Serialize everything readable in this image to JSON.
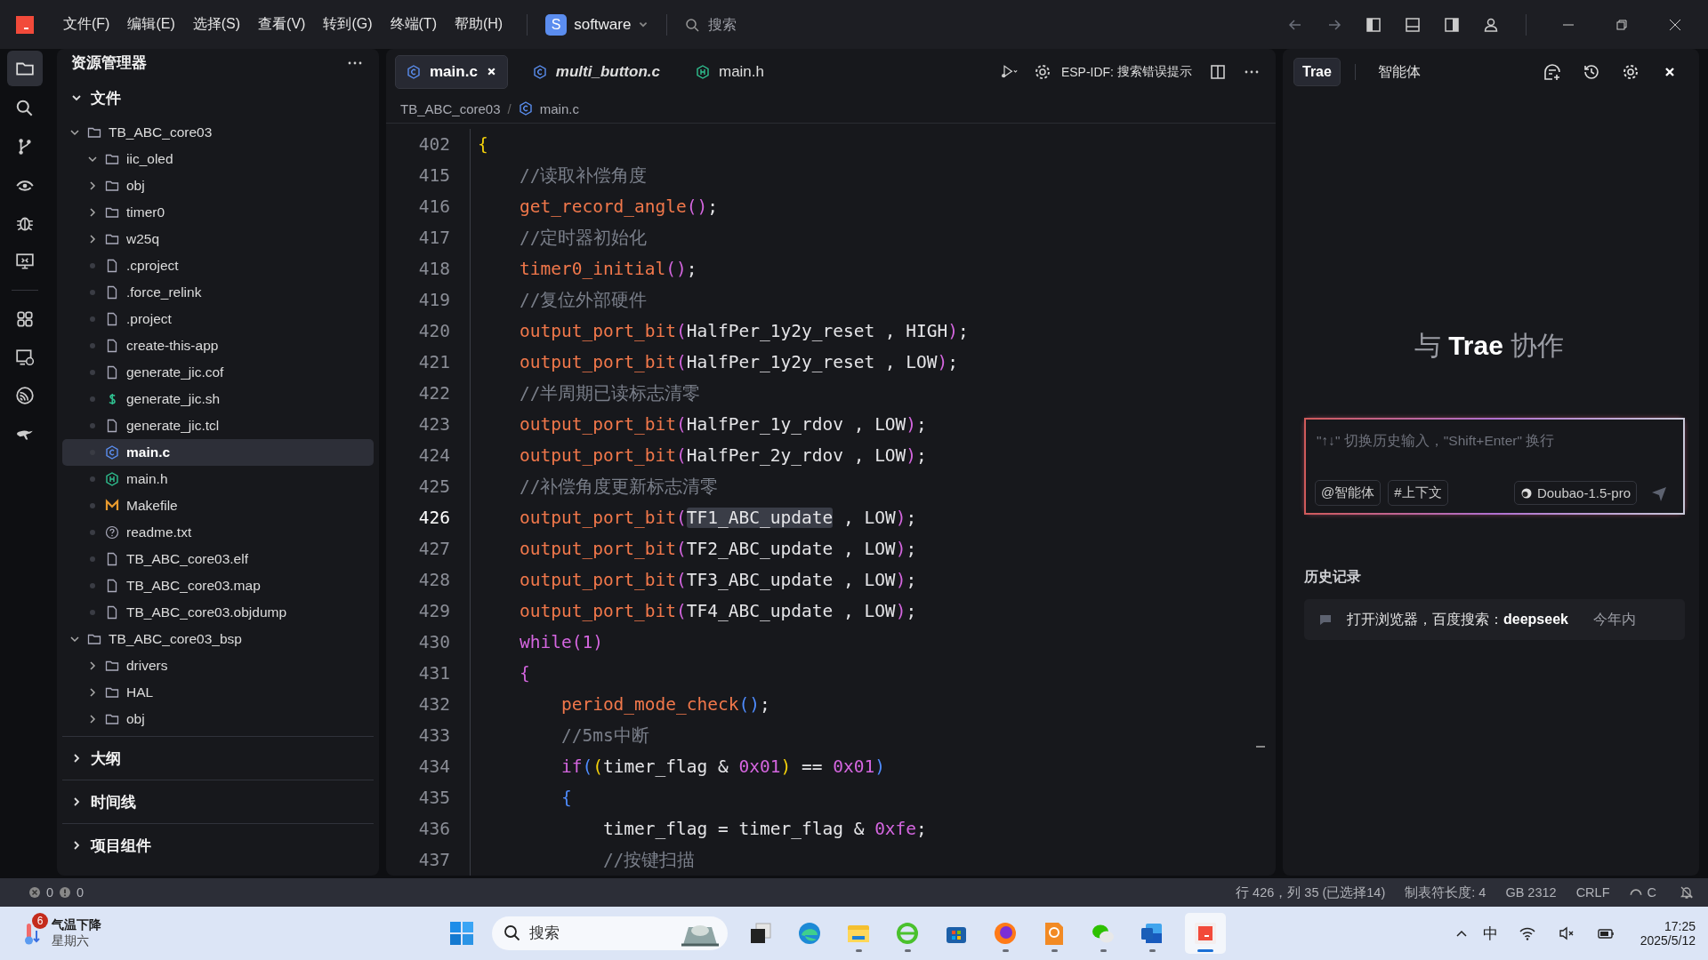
{
  "titlebar": {
    "menus": [
      "文件(F)",
      "编辑(E)",
      "选择(S)",
      "查看(V)",
      "转到(G)",
      "终端(T)",
      "帮助(H)"
    ],
    "project": {
      "badge": "S",
      "name": "software"
    },
    "search": {
      "placeholder": "搜索"
    }
  },
  "sidebar": {
    "title": "资源管理器",
    "sections": [
      {
        "title": "文件",
        "expanded": true,
        "tree": [
          {
            "name": "TB_ABC_core03",
            "kind": "folder",
            "expanded": true,
            "selected": false,
            "children": [
              {
                "name": "iic_oled",
                "kind": "folder",
                "expanded": true,
                "selected": false
              },
              {
                "name": "obj",
                "kind": "folder",
                "expanded": false,
                "selected": false
              },
              {
                "name": "timer0",
                "kind": "folder",
                "expanded": false,
                "selected": false
              },
              {
                "name": "w25q",
                "kind": "folder",
                "expanded": false,
                "selected": false
              },
              {
                "name": ".cproject",
                "kind": "file",
                "selected": false
              },
              {
                "name": ".force_relink",
                "kind": "file",
                "selected": false
              },
              {
                "name": ".project",
                "kind": "file",
                "selected": false
              },
              {
                "name": "create-this-app",
                "kind": "file",
                "selected": false
              },
              {
                "name": "generate_jic.cof",
                "kind": "file",
                "selected": false
              },
              {
                "name": "generate_jic.sh",
                "kind": "shell",
                "selected": false
              },
              {
                "name": "generate_jic.tcl",
                "kind": "file",
                "selected": false
              },
              {
                "name": "main.c",
                "kind": "c",
                "selected": true
              },
              {
                "name": "main.h",
                "kind": "h",
                "selected": false
              },
              {
                "name": "Makefile",
                "kind": "make",
                "selected": false
              },
              {
                "name": "readme.txt",
                "kind": "help",
                "selected": false
              },
              {
                "name": "TB_ABC_core03.elf",
                "kind": "file",
                "selected": false
              },
              {
                "name": "TB_ABC_core03.map",
                "kind": "file",
                "selected": false
              },
              {
                "name": "TB_ABC_core03.objdump",
                "kind": "file",
                "selected": false
              }
            ]
          },
          {
            "name": "TB_ABC_core03_bsp",
            "kind": "folder",
            "expanded": true,
            "selected": false,
            "children": [
              {
                "name": "drivers",
                "kind": "folder",
                "expanded": false,
                "selected": false
              },
              {
                "name": "HAL",
                "kind": "folder",
                "expanded": false,
                "selected": false
              },
              {
                "name": "obj",
                "kind": "folder",
                "expanded": false,
                "selected": false
              }
            ]
          }
        ]
      },
      {
        "title": "大纲",
        "expanded": false
      },
      {
        "title": "时间线",
        "expanded": false
      },
      {
        "title": "项目组件",
        "expanded": false
      }
    ]
  },
  "editor": {
    "tabs": [
      {
        "label": "main.c",
        "kind": "c",
        "selected": true,
        "preview": false
      },
      {
        "label": "multi_button.c",
        "kind": "c",
        "selected": false,
        "preview": true
      },
      {
        "label": "main.h",
        "kind": "h",
        "selected": false,
        "preview": false
      }
    ],
    "toolbar": {
      "label": "ESP-IDF:",
      "action": "搜索错误提示"
    },
    "breadcrumb": {
      "separator": "/",
      "items": [
        "TB_ABC_core03",
        "main.c"
      ]
    },
    "lines": [
      {
        "number": "402",
        "current": false,
        "tokens": [
          {
            "kind": "bracket1",
            "text": "{"
          }
        ]
      },
      {
        "number": "415",
        "current": false,
        "tokens": [
          {
            "kind": "comment",
            "text": "    //读取补偿角度"
          }
        ]
      },
      {
        "number": "416",
        "current": false,
        "tokens": [
          {
            "kind": "fn",
            "text": "    get_record_angle"
          },
          {
            "kind": "bracket2",
            "text": "()"
          },
          {
            "kind": "plain",
            "text": ";"
          }
        ]
      },
      {
        "number": "417",
        "current": false,
        "tokens": [
          {
            "kind": "comment",
            "text": "    //定时器初始化"
          }
        ]
      },
      {
        "number": "418",
        "current": false,
        "tokens": [
          {
            "kind": "fn",
            "text": "    timer0_initial"
          },
          {
            "kind": "bracket2",
            "text": "()"
          },
          {
            "kind": "plain",
            "text": ";"
          }
        ]
      },
      {
        "number": "419",
        "current": false,
        "tokens": [
          {
            "kind": "comment",
            "text": "    //复位外部硬件"
          }
        ]
      },
      {
        "number": "420",
        "current": false,
        "tokens": [
          {
            "kind": "fn",
            "text": "    output_port_bit"
          },
          {
            "kind": "bracket2",
            "text": "("
          },
          {
            "kind": "plain",
            "text": "HalfPer_1y2y_reset , HIGH"
          },
          {
            "kind": "bracket2",
            "text": ")"
          },
          {
            "kind": "plain",
            "text": ";"
          }
        ]
      },
      {
        "number": "421",
        "current": false,
        "tokens": [
          {
            "kind": "fn",
            "text": "    output_port_bit"
          },
          {
            "kind": "bracket2",
            "text": "("
          },
          {
            "kind": "plain",
            "text": "HalfPer_1y2y_reset , LOW"
          },
          {
            "kind": "bracket2",
            "text": ")"
          },
          {
            "kind": "plain",
            "text": ";"
          }
        ]
      },
      {
        "number": "422",
        "current": false,
        "tokens": [
          {
            "kind": "comment",
            "text": "    //半周期已读标志清零"
          }
        ]
      },
      {
        "number": "423",
        "current": false,
        "tokens": [
          {
            "kind": "fn",
            "text": "    output_port_bit"
          },
          {
            "kind": "bracket2",
            "text": "("
          },
          {
            "kind": "plain",
            "text": "HalfPer_1y_rdov , LOW"
          },
          {
            "kind": "bracket2",
            "text": ")"
          },
          {
            "kind": "plain",
            "text": ";"
          }
        ]
      },
      {
        "number": "424",
        "current": false,
        "tokens": [
          {
            "kind": "fn",
            "text": "    output_port_bit"
          },
          {
            "kind": "bracket2",
            "text": "("
          },
          {
            "kind": "plain",
            "text": "HalfPer_2y_rdov , LOW"
          },
          {
            "kind": "bracket2",
            "text": ")"
          },
          {
            "kind": "plain",
            "text": ";"
          }
        ]
      },
      {
        "number": "425",
        "current": false,
        "tokens": [
          {
            "kind": "comment",
            "text": "    //补偿角度更新标志清零"
          }
        ]
      },
      {
        "number": "426",
        "current": true,
        "tokens": [
          {
            "kind": "fn",
            "text": "    output_port_bit"
          },
          {
            "kind": "bracket2",
            "text": "("
          },
          {
            "kind": "selection",
            "text": "TF1_ABC_update"
          },
          {
            "kind": "plain",
            "text": " , LOW"
          },
          {
            "kind": "bracket2",
            "text": ")"
          },
          {
            "kind": "plain",
            "text": ";"
          }
        ]
      },
      {
        "number": "427",
        "current": false,
        "tokens": [
          {
            "kind": "fn",
            "text": "    output_port_bit"
          },
          {
            "kind": "bracket2",
            "text": "("
          },
          {
            "kind": "plain",
            "text": "TF2_ABC_update , LOW"
          },
          {
            "kind": "bracket2",
            "text": ")"
          },
          {
            "kind": "plain",
            "text": ";"
          }
        ]
      },
      {
        "number": "428",
        "current": false,
        "tokens": [
          {
            "kind": "fn",
            "text": "    output_port_bit"
          },
          {
            "kind": "bracket2",
            "text": "("
          },
          {
            "kind": "plain",
            "text": "TF3_ABC_update , LOW"
          },
          {
            "kind": "bracket2",
            "text": ")"
          },
          {
            "kind": "plain",
            "text": ";"
          }
        ]
      },
      {
        "number": "429",
        "current": false,
        "tokens": [
          {
            "kind": "fn",
            "text": "    output_port_bit"
          },
          {
            "kind": "bracket2",
            "text": "("
          },
          {
            "kind": "plain",
            "text": "TF4_ABC_update , LOW"
          },
          {
            "kind": "bracket2",
            "text": ")"
          },
          {
            "kind": "plain",
            "text": ";"
          }
        ]
      },
      {
        "number": "430",
        "current": false,
        "tokens": [
          {
            "kind": "keyword",
            "text": "    while"
          },
          {
            "kind": "bracket2",
            "text": "("
          },
          {
            "kind": "number",
            "text": "1"
          },
          {
            "kind": "bracket2",
            "text": ")"
          }
        ]
      },
      {
        "number": "431",
        "current": false,
        "tokens": [
          {
            "kind": "bracket2",
            "text": "    {"
          }
        ]
      },
      {
        "number": "432",
        "current": false,
        "tokens": [
          {
            "kind": "fn",
            "text": "        period_mode_check"
          },
          {
            "kind": "bracket3",
            "text": "()"
          },
          {
            "kind": "plain",
            "text": ";"
          }
        ]
      },
      {
        "number": "433",
        "current": false,
        "tokens": [
          {
            "kind": "comment",
            "text": "        //5ms中断"
          }
        ]
      },
      {
        "number": "434",
        "current": false,
        "tokens": [
          {
            "kind": "keyword",
            "text": "        if"
          },
          {
            "kind": "bracket3",
            "text": "("
          },
          {
            "kind": "bracket1",
            "text": "("
          },
          {
            "kind": "plain",
            "text": "timer_flag & "
          },
          {
            "kind": "number",
            "text": "0x01"
          },
          {
            "kind": "bracket1",
            "text": ")"
          },
          {
            "kind": "plain",
            "text": " == "
          },
          {
            "kind": "number",
            "text": "0x01"
          },
          {
            "kind": "bracket3",
            "text": ")"
          }
        ]
      },
      {
        "number": "435",
        "current": false,
        "tokens": [
          {
            "kind": "bracket3",
            "text": "        {"
          }
        ]
      },
      {
        "number": "436",
        "current": false,
        "tokens": [
          {
            "kind": "plain",
            "text": "            timer_flag = timer_flag & "
          },
          {
            "kind": "number",
            "text": "0xfe"
          },
          {
            "kind": "plain",
            "text": ";"
          }
        ]
      },
      {
        "number": "437",
        "current": false,
        "tokens": [
          {
            "kind": "comment",
            "text": "            //按键扫描"
          }
        ]
      }
    ]
  },
  "assistant": {
    "tabs": [
      {
        "label": "Trae",
        "selected": true
      },
      {
        "label": "智能体",
        "selected": false
      }
    ],
    "heading": "与 **Trae** 协作",
    "input": {
      "placeholder": "\"↑↓\" 切换历史输入，\"Shift+Enter\" 换行",
      "chips": [
        "@智能体",
        "#上下文"
      ],
      "model": "Doubao-1.5-pro"
    },
    "history": {
      "title": "历史记录",
      "items": [
        {
          "text": "打开浏览器，百度搜索：**deepseek**",
          "time": "今年内"
        }
      ]
    }
  },
  "status_bar": {
    "errors": "0",
    "warnings": "0",
    "items": [
      "行 426，列 35 (已选择14)",
      "制表符长度: 4",
      "GB 2312",
      "CRLF"
    ],
    "language": "C"
  },
  "taskbar": {
    "weather": {
      "badge": "6",
      "title": "气温下降",
      "subtitle": "星期六"
    },
    "search": {
      "placeholder": "搜索"
    },
    "apps": [
      {
        "kind": "taskview",
        "running": false,
        "active": false
      },
      {
        "kind": "edge",
        "running": false,
        "active": false
      },
      {
        "kind": "explorer",
        "running": true,
        "active": false
      },
      {
        "kind": "ie",
        "running": true,
        "active": false
      },
      {
        "kind": "store",
        "running": false,
        "active": false
      },
      {
        "kind": "firefox",
        "running": true,
        "active": false
      },
      {
        "kind": "pdf",
        "running": true,
        "active": false
      },
      {
        "kind": "wechat",
        "running": true,
        "active": false
      },
      {
        "kind": "word",
        "running": true,
        "active": false
      },
      {
        "kind": "trae",
        "running": true,
        "active": true
      }
    ],
    "ime": "中",
    "time": "17:25",
    "date": "2025/5/12"
  }
}
